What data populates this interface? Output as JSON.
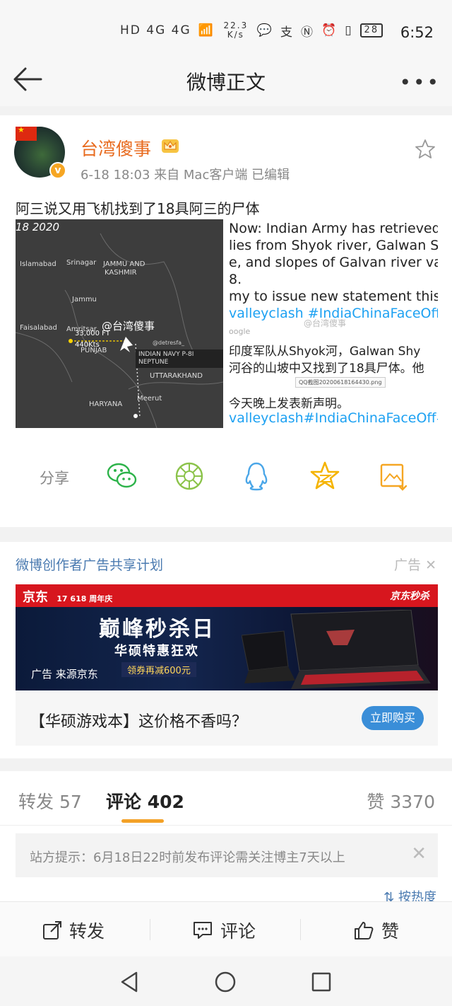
{
  "status_bar": {
    "network": "HD 4G 4G",
    "speed": "22.3 K/s",
    "battery": "28",
    "time": "6:52"
  },
  "header": {
    "title": "微博正文"
  },
  "post": {
    "username": "台湾傻事",
    "meta": "6-18 18:03   来自 Mac客户端   已编辑",
    "text": "阿三说又用飞机找到了18具阿三的尸体",
    "image_left": {
      "date": "18 2020",
      "watermark": "@台湾傻事",
      "labels": [
        "JAMMU AND",
        "KASHMIR",
        "Srinagar",
        "Islamabad",
        "Jammu",
        "Faisalabad",
        "Amritsar",
        "PUNJAB",
        "HARYANA",
        "UTTARAKHAND",
        "Meerut"
      ],
      "altitude": "33,000 FT",
      "speed": "440Kts",
      "aircraft": "INDIAN NAVY P-8I NEPTUNE",
      "handle": "@detresfa_"
    },
    "image_right": {
      "lines": [
        "Now: Indian Army has retrieved",
        "lies from Shyok river, Galwan Shy",
        "e, and slopes of Galvan river vall",
        "8.",
        "my to issue new statement this e",
        "valleyclash #IndiaChinaFaceOff #L",
        "oogle",
        "印度军队从Shyok河，Galwan Shy",
        "河谷的山坡中又找到了18具尸体。他",
        "今天晚上发表新声明。",
        "valleyclash#IndiaChinaFaceOff#La"
      ],
      "file_label": "QQ截图20200618164430.png",
      "watermark": "@台湾傻事"
    },
    "share_label": "分享"
  },
  "ad": {
    "header": "微博创作者广告共享计划",
    "tag": "广告",
    "banner": {
      "brand": "京东",
      "anniv": "17 618 周年庆",
      "brand_right": "京东秒杀",
      "headline": "巅峰秒杀日",
      "subline": "华硕特惠狂欢",
      "coupon": "领券再减600元",
      "source": "广告 来源京东"
    },
    "title": "【华硕游戏本】这价格不香吗？",
    "button": "立即购买"
  },
  "tabs": {
    "repost": "转发 57",
    "comment": "评论 402",
    "like": "赞 3370"
  },
  "notice": {
    "text": "站方提示：6月18日22时前发布评论需关注博主7天以上"
  },
  "sort_label": "按热度",
  "actions": {
    "repost": "转发",
    "comment": "评论",
    "like": "赞"
  },
  "colors": {
    "accent": "#e86b1f",
    "link": "#4a7ab0",
    "tab_underline": "#f3a127",
    "button": "#3a8ed8"
  }
}
